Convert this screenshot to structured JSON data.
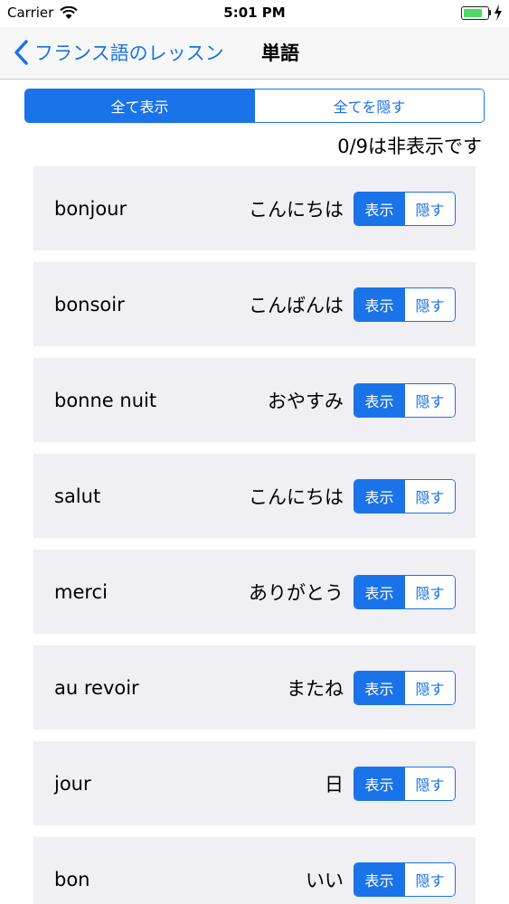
{
  "status_bar": {
    "carrier": "Carrier",
    "time": "5:01 PM",
    "battery_level": 0.85
  },
  "nav": {
    "back_label": "フランス語のレッスン",
    "title": "単語"
  },
  "controls": {
    "show_all": "全て表示",
    "hide_all": "全てを隠す",
    "hidden_count": "0/9は非表示です"
  },
  "row_buttons": {
    "show": "表示",
    "hide": "隠す"
  },
  "words": [
    {
      "word": "bonjour",
      "meaning": "こんにちは"
    },
    {
      "word": "bonsoir",
      "meaning": "こんばんは"
    },
    {
      "word": "bonne nuit",
      "meaning": "おやすみ"
    },
    {
      "word": "salut",
      "meaning": "こんにちは"
    },
    {
      "word": "merci",
      "meaning": "ありがとう"
    },
    {
      "word": "au revoir",
      "meaning": "またね"
    },
    {
      "word": "jour",
      "meaning": "日"
    },
    {
      "word": "bon",
      "meaning": "いい"
    }
  ],
  "colors": {
    "accent": "#1a73e8",
    "row_background": "#efeff4",
    "battery": "#4cd964"
  }
}
